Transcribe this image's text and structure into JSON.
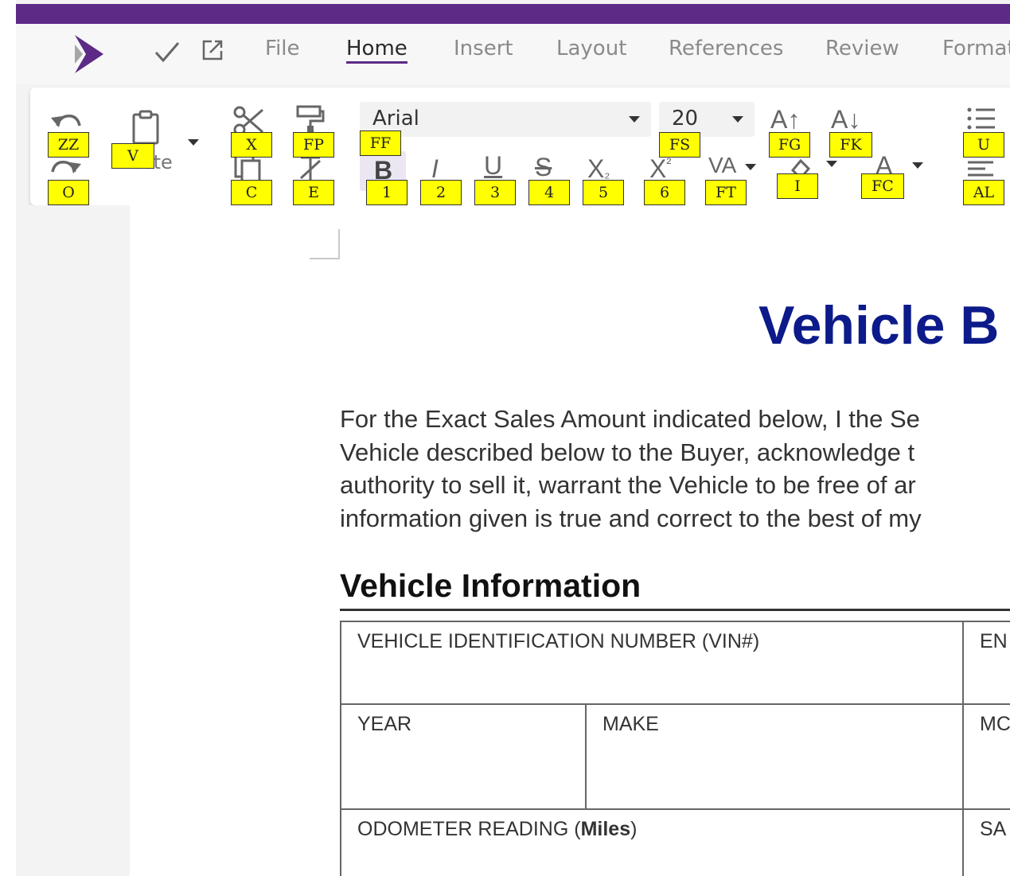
{
  "menu": {
    "tabs": [
      "File",
      "Home",
      "Insert",
      "Layout",
      "References",
      "Review",
      "Format"
    ],
    "active_tab": "Home"
  },
  "ribbon": {
    "font_name": "Arial",
    "font_size": "20",
    "paste_label": "Paste"
  },
  "hints": {
    "undo": "ZZ",
    "redo": "O",
    "paste": "V",
    "cut": "X",
    "copy": "C",
    "format_painter": "FP",
    "clear_format": "E",
    "font_family": "FF",
    "bold": "1",
    "italic": "2",
    "underline": "3",
    "strikethrough": "4",
    "subscript": "5",
    "superscript": "6",
    "font_size": "FS",
    "font_spacing": "FT",
    "grow_font": "FG",
    "shrink_font": "FK",
    "highlight": "I",
    "font_color": "FC",
    "bullets": "U",
    "align": "AL"
  },
  "document": {
    "title": "Vehicle B",
    "intro_lines": [
      "For the Exact Sales Amount indicated below, I the Se",
      "Vehicle described below to the Buyer, acknowledge t",
      "authority to sell it, warrant the Vehicle to be free of ar",
      "information given is true and correct to the best of my"
    ],
    "section_heading": "Vehicle Information",
    "table": {
      "vin_label": "VEHICLE IDENTIFICATION NUMBER (VIN#)",
      "engine_label": "EN",
      "year_label": "YEAR",
      "make_label": "MAKE",
      "model_label": "MC",
      "odometer_prefix": "ODOMETER READING (",
      "odometer_bold": "Miles",
      "odometer_suffix": ")",
      "sale_label": "SA"
    }
  },
  "colors": {
    "brand": "#5d2a86",
    "title": "#0c1a8a",
    "hint_bg": "#ffff00"
  }
}
